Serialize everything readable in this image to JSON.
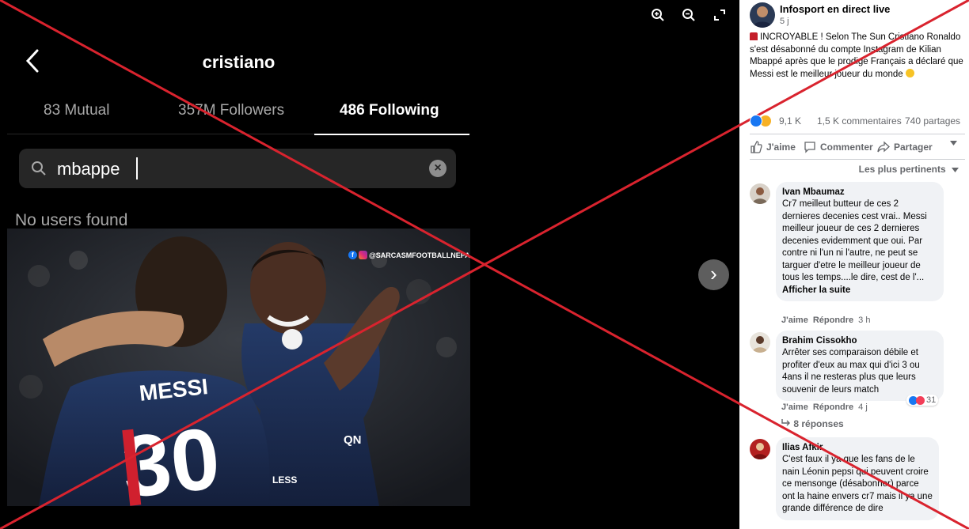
{
  "viewer": {
    "tools": {
      "zoom_in": "zoom-in-icon",
      "zoom_out": "zoom-out-icon",
      "fullscreen": "fullscreen-icon"
    }
  },
  "instagram": {
    "username": "cristiano",
    "tabs": [
      "83 Mutual",
      "357M Followers",
      "486 Following"
    ],
    "active_tab": "486 Following",
    "search_query": "mbappe",
    "empty_message": "No users found",
    "watermark": "@SARCASMFOOTBALLNEPAL",
    "jersey_name": "MESSI",
    "jersey_number": "30",
    "sponsor_text": "QN",
    "shorts_text": "LESS"
  },
  "post": {
    "page_name": "Infosport en direct live",
    "time": "5 j",
    "text": "INCROYABLE ! Selon The Sun Cristiano Ronaldo s'est désabonné du compte Instagram de Kilian Mbappé après que le prodige Français a déclaré que Messi est le meilleur joueur du monde",
    "reactions_count": "9,1 K",
    "comments_count": "1,5 K commentaires",
    "shares_count": "740 partages",
    "actions": {
      "like": "J'aime",
      "comment": "Commenter",
      "share": "Partager"
    },
    "sort_label": "Les plus pertinents"
  },
  "comments": [
    {
      "author": "Ivan Mbaumaz",
      "text": "Cr7 meilleut butteur de ces 2 dernieres decenies cest vrai.. Messi meilleur joueur de ces 2 dernieres decenies evidemment que oui. Par contre ni l'un ni l'autre, ne peut se targuer d'etre le meilleur joueur de tous les temps....le dire, cest de l'...",
      "more": "Afficher la suite",
      "like": "J'aime",
      "reply": "Répondre",
      "time": "3 h"
    },
    {
      "author": "Brahim Cissokho",
      "text": "Arrêter ses comparaison débile et profiter d'eux au max qui d'ici 3 ou 4ans il ne resteras plus que leurs souvenir de leurs match",
      "like": "J'aime",
      "reply": "Répondre",
      "time": "4 j",
      "reactions": "31",
      "replies": "8 réponses"
    },
    {
      "author": "Ilias Afkir",
      "text": "C'est faux il ya que les fans de le nain Léonin pepsi qui peuvent croire ce mensonge (désabonner) parce ont la haine envers cr7 mais il ya une grande différence de dire"
    }
  ],
  "colors": {
    "cross": "#d9232e",
    "fb_blue": "#1877f2",
    "muted": "#65676b"
  }
}
